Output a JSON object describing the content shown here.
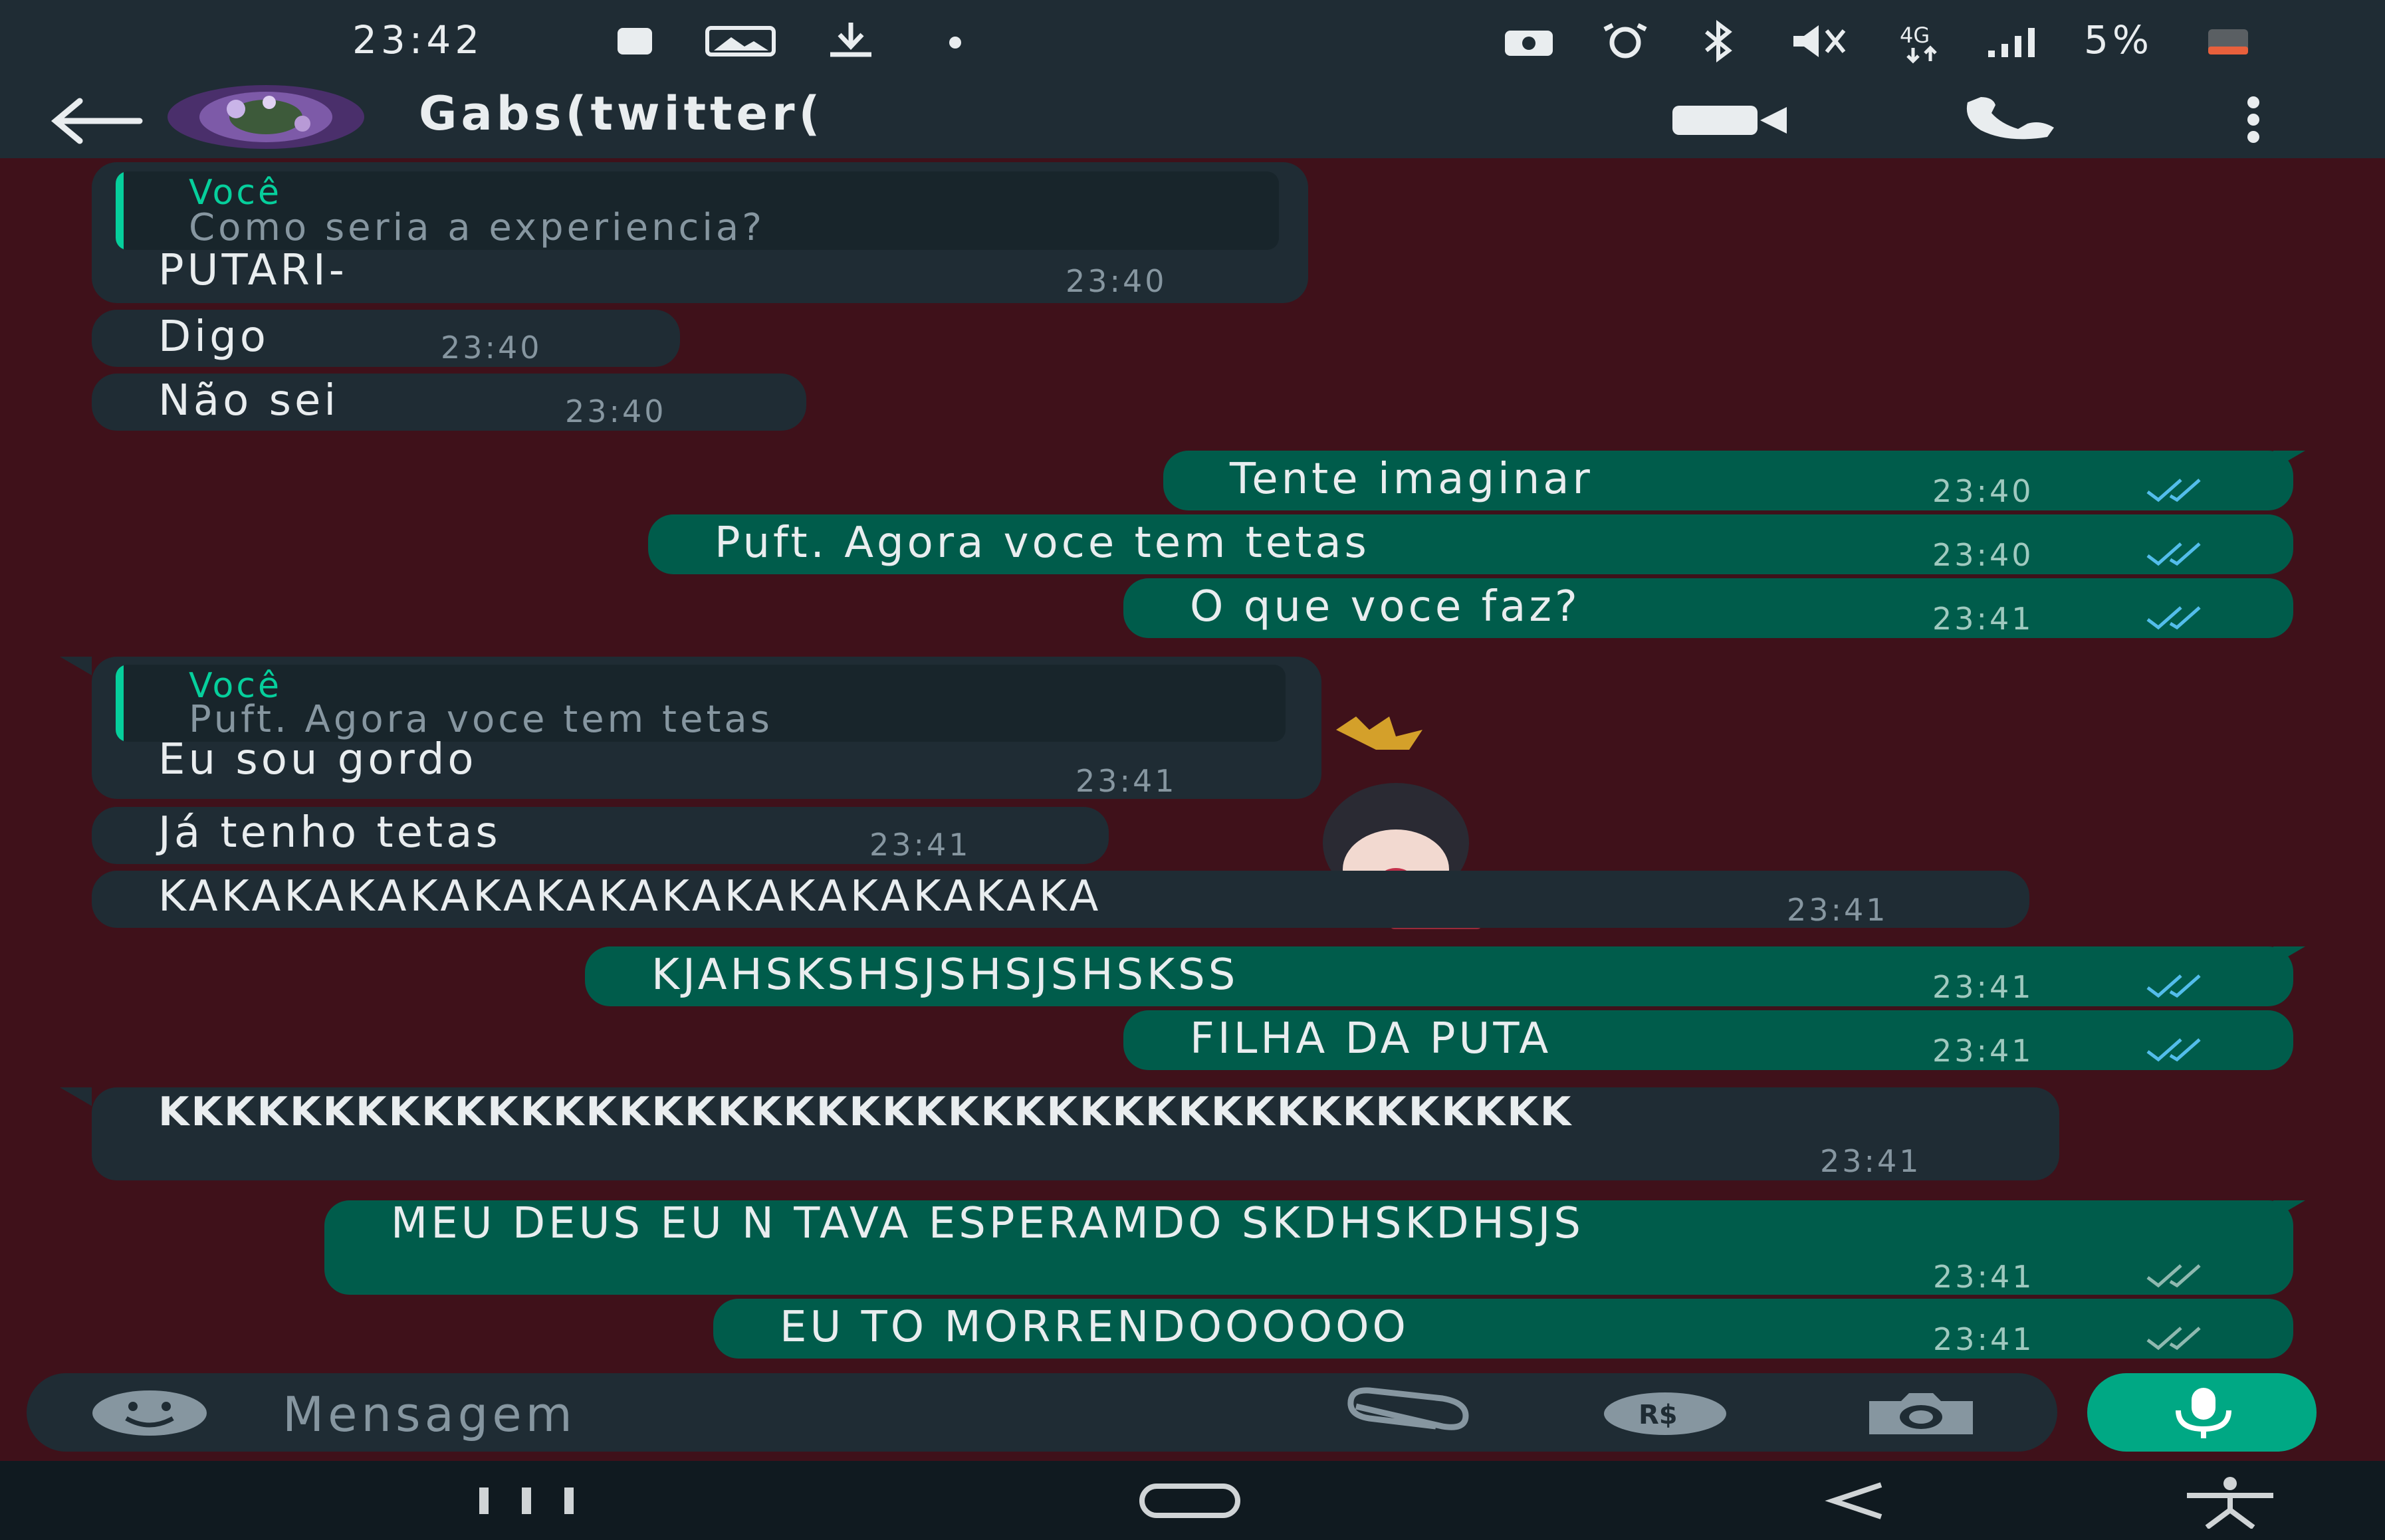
{
  "status_bar": {
    "time": "23:42",
    "network": "4G",
    "battery": "5%"
  },
  "header": {
    "contact_name": "Gabs(twitter(",
    "icons": [
      "back-arrow-icon",
      "avatar",
      "video-call-icon",
      "voice-call-icon",
      "more-options-icon"
    ]
  },
  "messages": [
    {
      "direction": "in",
      "quote_author": "Você",
      "quote_text": "Como seria a experiencia?",
      "text": "PUTARI-",
      "time": "23:40"
    },
    {
      "direction": "in",
      "text": "Digo",
      "time": "23:40"
    },
    {
      "direction": "in",
      "text": "Não sei",
      "time": "23:40"
    },
    {
      "direction": "out",
      "text": "Tente imaginar",
      "time": "23:40",
      "status": "read"
    },
    {
      "direction": "out",
      "text": "Puft. Agora voce tem tetas",
      "time": "23:40",
      "status": "read"
    },
    {
      "direction": "out",
      "text": "O que voce faz?",
      "time": "23:41",
      "status": "read"
    },
    {
      "direction": "in",
      "quote_author": "Você",
      "quote_text": "Puft. Agora voce tem tetas",
      "text": "Eu sou gordo",
      "time": "23:41"
    },
    {
      "direction": "in",
      "text": "Já tenho tetas",
      "time": "23:41"
    },
    {
      "direction": "in",
      "text": "KAKAKAKAKAKAKAKAKAKAKAKAKAKAKA",
      "time": "23:41"
    },
    {
      "direction": "out",
      "text": "KJAHSKSHSJSHSJSHSKSS",
      "time": "23:41",
      "status": "read"
    },
    {
      "direction": "out",
      "text": "FILHA DA PUTA",
      "time": "23:41",
      "status": "read"
    },
    {
      "direction": "in",
      "text": "KKKKKKKKKKKKKKKKKKKKKKKKKKKKKKKKKKKKKKKKKKK",
      "time": "23:41"
    },
    {
      "direction": "out",
      "text": "MEU DEUS EU N TAVA ESPERAMDO SKDHSKDHSJS",
      "time": "23:41",
      "status": "delivered"
    },
    {
      "direction": "out",
      "text": "EU TO MORRENDOOOOOO",
      "time": "23:41",
      "status": "delivered"
    }
  ],
  "input": {
    "placeholder": "Mensagem",
    "icons": [
      "emoji-icon",
      "attach-icon",
      "payment-icon",
      "camera-icon",
      "mic-icon"
    ]
  },
  "colors": {
    "header_bg": "#1f2c34",
    "chat_bg": "#3f111a",
    "incoming_bubble": "#1f2c34",
    "outgoing_bubble": "#005c4b",
    "accent": "#00a884",
    "read_ticks": "#53bdeb"
  }
}
